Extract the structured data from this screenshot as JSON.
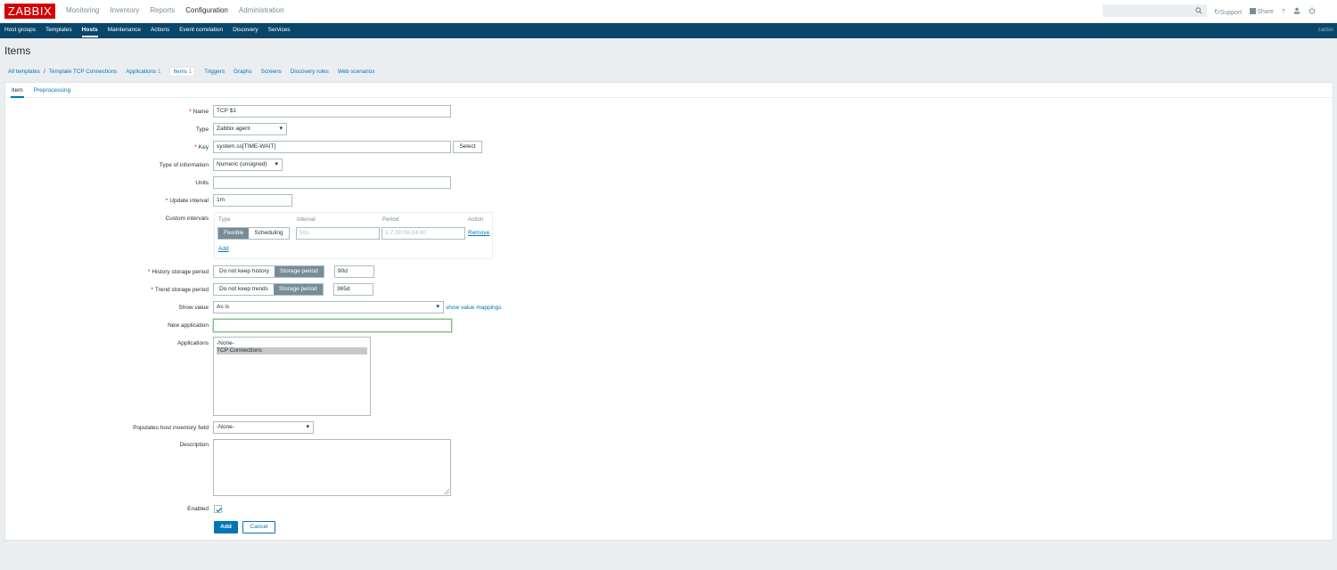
{
  "topbar": {
    "logo": "ZABBIX",
    "menu": [
      "Monitoring",
      "Inventory",
      "Reports",
      "Configuration",
      "Administration"
    ],
    "support": "Support",
    "share": "Share",
    "help": "?"
  },
  "submenu": {
    "items": [
      "Host groups",
      "Templates",
      "Hosts",
      "Maintenance",
      "Actions",
      "Event correlation",
      "Discovery",
      "Services"
    ],
    "user": "zabbix"
  },
  "page": {
    "title": "Items"
  },
  "breadcrumbs": {
    "all_templates": "All templates",
    "sep": "/",
    "template": "Template TCP Connections",
    "applications": "Applications",
    "applications_count": "1",
    "items": "Items",
    "items_count": "1",
    "triggers": "Triggers",
    "graphs": "Graphs",
    "screens": "Screens",
    "discovery_rules": "Discovery rules",
    "web_scenarios": "Web scenarios"
  },
  "tabs": {
    "item": "Item",
    "preprocessing": "Preprocessing"
  },
  "form": {
    "name_label": "Name",
    "name_value": "TCP $1",
    "type_label": "Type",
    "type_value": "Zabbix agent",
    "key_label": "Key",
    "key_value": "system.ss[TIME-WAIT]",
    "key_select": "Select",
    "type_info_label": "Type of information",
    "type_info_value": "Numeric (unsigned)",
    "units_label": "Units",
    "units_value": "",
    "update_label": "Update interval",
    "update_value": "1m",
    "custom_label": "Custom intervals",
    "custom_headers": {
      "type": "Type",
      "interval": "Interval",
      "period": "Period",
      "action": "Action"
    },
    "custom_row": {
      "flexible": "Flexible",
      "scheduling": "Scheduling",
      "interval_placeholder": "50s",
      "period_placeholder": "1-7,00:00-24:00",
      "remove": "Remove"
    },
    "custom_add": "Add",
    "history_label": "History storage period",
    "history_no_keep": "Do not keep history",
    "history_storage": "Storage period",
    "history_value": "90d",
    "trend_label": "Trend storage period",
    "trend_no_keep": "Do not keep trends",
    "trend_storage": "Storage period",
    "trend_value": "365d",
    "show_value_label": "Show value",
    "show_value_value": "As is",
    "show_value_link": "show value mappings",
    "new_app_label": "New application",
    "new_app_value": "",
    "applications_label": "Applications",
    "applications_options": [
      "-None-",
      "TCP Connections"
    ],
    "inventory_label": "Populates host inventory field",
    "inventory_value": "-None-",
    "description_label": "Description",
    "description_value": "",
    "enabled_label": "Enabled",
    "enabled": true,
    "add_button": "Add",
    "cancel_button": "Cancel"
  }
}
